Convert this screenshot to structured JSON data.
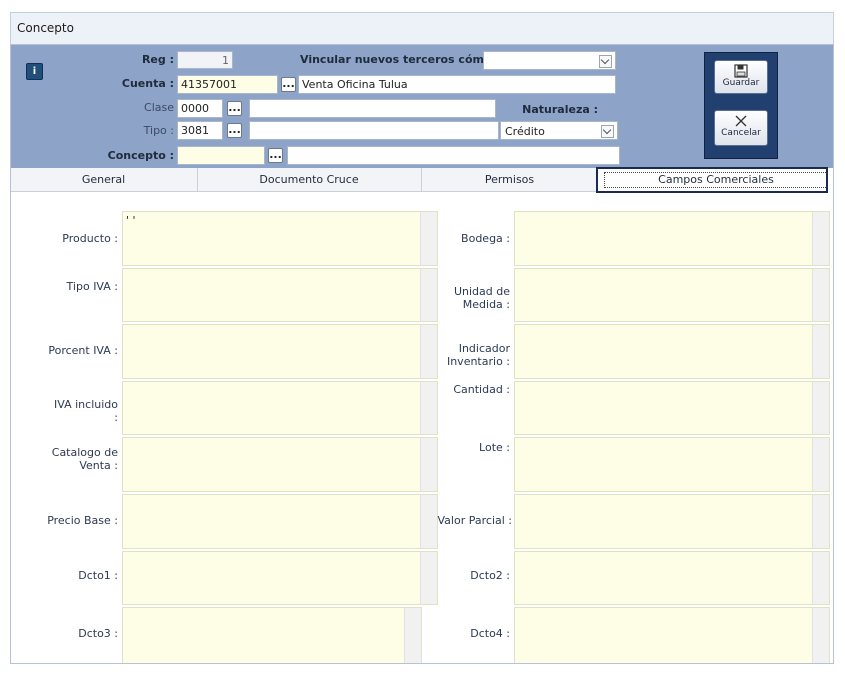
{
  "window": {
    "title": "Concepto"
  },
  "info_button": "i",
  "header": {
    "reg_label": "Reg :",
    "reg_value": "1",
    "vincular_label": "Vincular nuevos terceros cómo :",
    "vincular_value": "",
    "cuenta_label": "Cuenta :",
    "cuenta_code": "41357001",
    "cuenta_desc": "Venta Oficina Tulua",
    "clase_label": "Clase",
    "clase_code": "0000",
    "clase_desc": "",
    "tipo_label": "Tipo :",
    "tipo_code": "3081",
    "tipo_desc": "",
    "naturaleza_label": "Naturaleza :",
    "naturaleza_value": "Crédito",
    "concepto_label": "Concepto :",
    "concepto_code": "",
    "concepto_desc": "",
    "browse_label": "..."
  },
  "buttons": {
    "save": "Guardar",
    "cancel": "Cancelar"
  },
  "tabs": [
    {
      "label": "General"
    },
    {
      "label": "Documento Cruce"
    },
    {
      "label": "Permisos"
    },
    {
      "label": "Campos Comerciales"
    }
  ],
  "fields_left": [
    {
      "label": "Producto :",
      "value": "' '"
    },
    {
      "label": "Tipo IVA :",
      "value": ""
    },
    {
      "label": "Porcent IVA :",
      "value": ""
    },
    {
      "label": "IVA incluido :",
      "value": ""
    },
    {
      "label": "Catalogo de Venta :",
      "value": ""
    },
    {
      "label": "Precio Base :",
      "value": ""
    },
    {
      "label": "Dcto1 :",
      "value": ""
    },
    {
      "label": "Dcto3 :",
      "value": ""
    }
  ],
  "fields_right": [
    {
      "label": "Bodega :",
      "value": ""
    },
    {
      "label": "Unidad de Medida :",
      "value": ""
    },
    {
      "label": "Indicador Inventario :",
      "value": ""
    },
    {
      "label": "Cantidad :",
      "value": ""
    },
    {
      "label": "Lote :",
      "value": ""
    },
    {
      "label": "Valor Parcial :",
      "value": ""
    },
    {
      "label": "Dcto2 :",
      "value": ""
    },
    {
      "label": "Dcto4 :",
      "value": ""
    }
  ]
}
